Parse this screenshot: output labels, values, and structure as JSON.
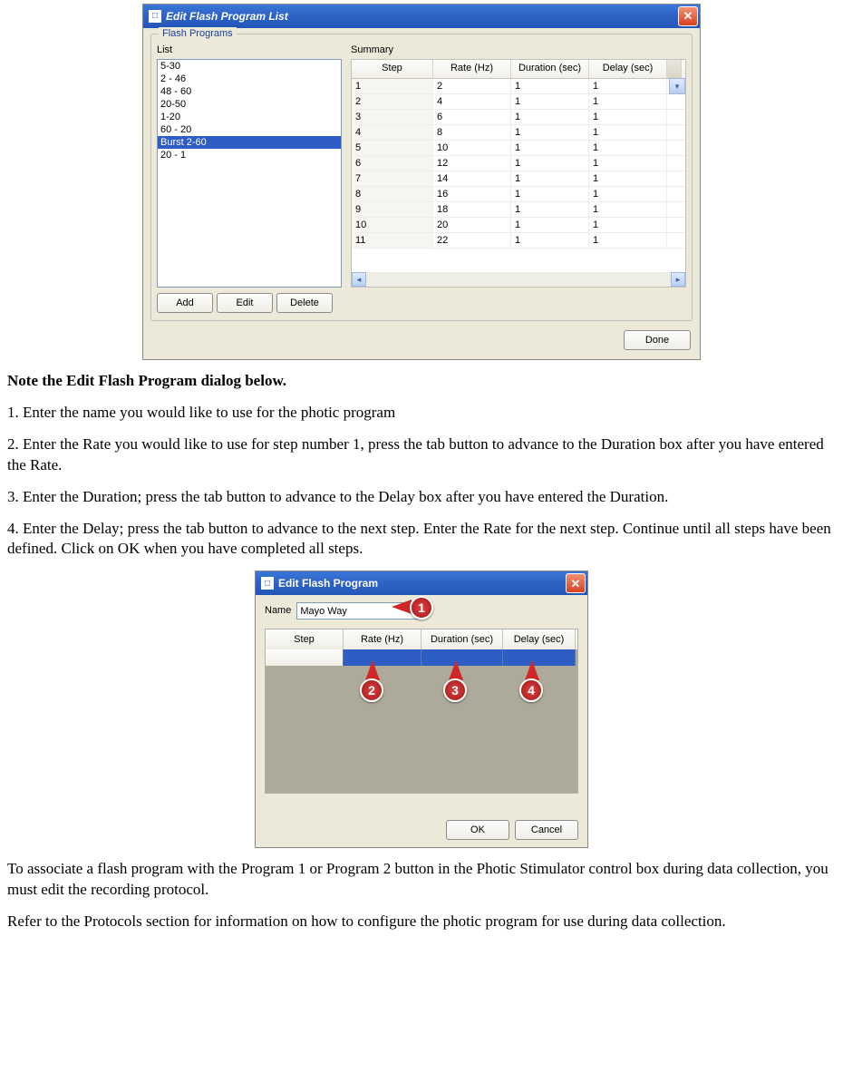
{
  "dialog1": {
    "title": "Edit Flash Program List",
    "groupbox_title": "Flash Programs",
    "list_label": "List",
    "summary_label": "Summary",
    "list_items": [
      "5-30",
      "2 - 46",
      "48 - 60",
      "20-50",
      "1-20",
      "60 - 20",
      "Burst 2-60",
      "20 - 1"
    ],
    "selected_index": 6,
    "summary_headers": [
      "Step",
      "Rate (Hz)",
      "Duration (sec)",
      "Delay (sec)"
    ],
    "summary_rows": [
      {
        "step": "1",
        "rate": "2",
        "dur": "1",
        "del": "1"
      },
      {
        "step": "2",
        "rate": "4",
        "dur": "1",
        "del": "1"
      },
      {
        "step": "3",
        "rate": "6",
        "dur": "1",
        "del": "1"
      },
      {
        "step": "4",
        "rate": "8",
        "dur": "1",
        "del": "1"
      },
      {
        "step": "5",
        "rate": "10",
        "dur": "1",
        "del": "1"
      },
      {
        "step": "6",
        "rate": "12",
        "dur": "1",
        "del": "1"
      },
      {
        "step": "7",
        "rate": "14",
        "dur": "1",
        "del": "1"
      },
      {
        "step": "8",
        "rate": "16",
        "dur": "1",
        "del": "1"
      },
      {
        "step": "9",
        "rate": "18",
        "dur": "1",
        "del": "1"
      },
      {
        "step": "10",
        "rate": "20",
        "dur": "1",
        "del": "1"
      },
      {
        "step": "11",
        "rate": "22",
        "dur": "1",
        "del": "1"
      }
    ],
    "buttons": {
      "add": "Add",
      "edit": "Edit",
      "delete": "Delete",
      "done": "Done"
    }
  },
  "doc": {
    "heading": "Note the Edit Flash Program dialog below.",
    "step1": "1.  Enter the name you would like to use for the photic program",
    "step2": "2.  Enter the Rate you would like to use for step number 1, press the tab button to advance to the Duration box after you have entered the Rate.",
    "step3": "3.  Enter the Duration; press the tab button to advance to the Delay box after you have entered the Duration.",
    "step4": "4.  Enter the Delay; press the tab button to advance to the next step.  Enter the Rate for the next step.  Continue until all steps have been defined.  Click on OK when you have completed all steps.",
    "para_after1": "To associate a flash program with the Program 1 or Program 2 button in the Photic Stimulator control box during data collection, you must edit the recording protocol.",
    "para_after2": "Refer to the Protocols section for information on how to configure the photic program for use during data collection."
  },
  "dialog2": {
    "title": "Edit Flash Program",
    "name_label": "Name",
    "name_value": "Mayo Way",
    "headers": [
      "Step",
      "Rate (Hz)",
      "Duration (sec)",
      "Delay (sec)"
    ],
    "buttons": {
      "ok": "OK",
      "cancel": "Cancel"
    },
    "callouts": [
      "1",
      "2",
      "3",
      "4"
    ]
  }
}
